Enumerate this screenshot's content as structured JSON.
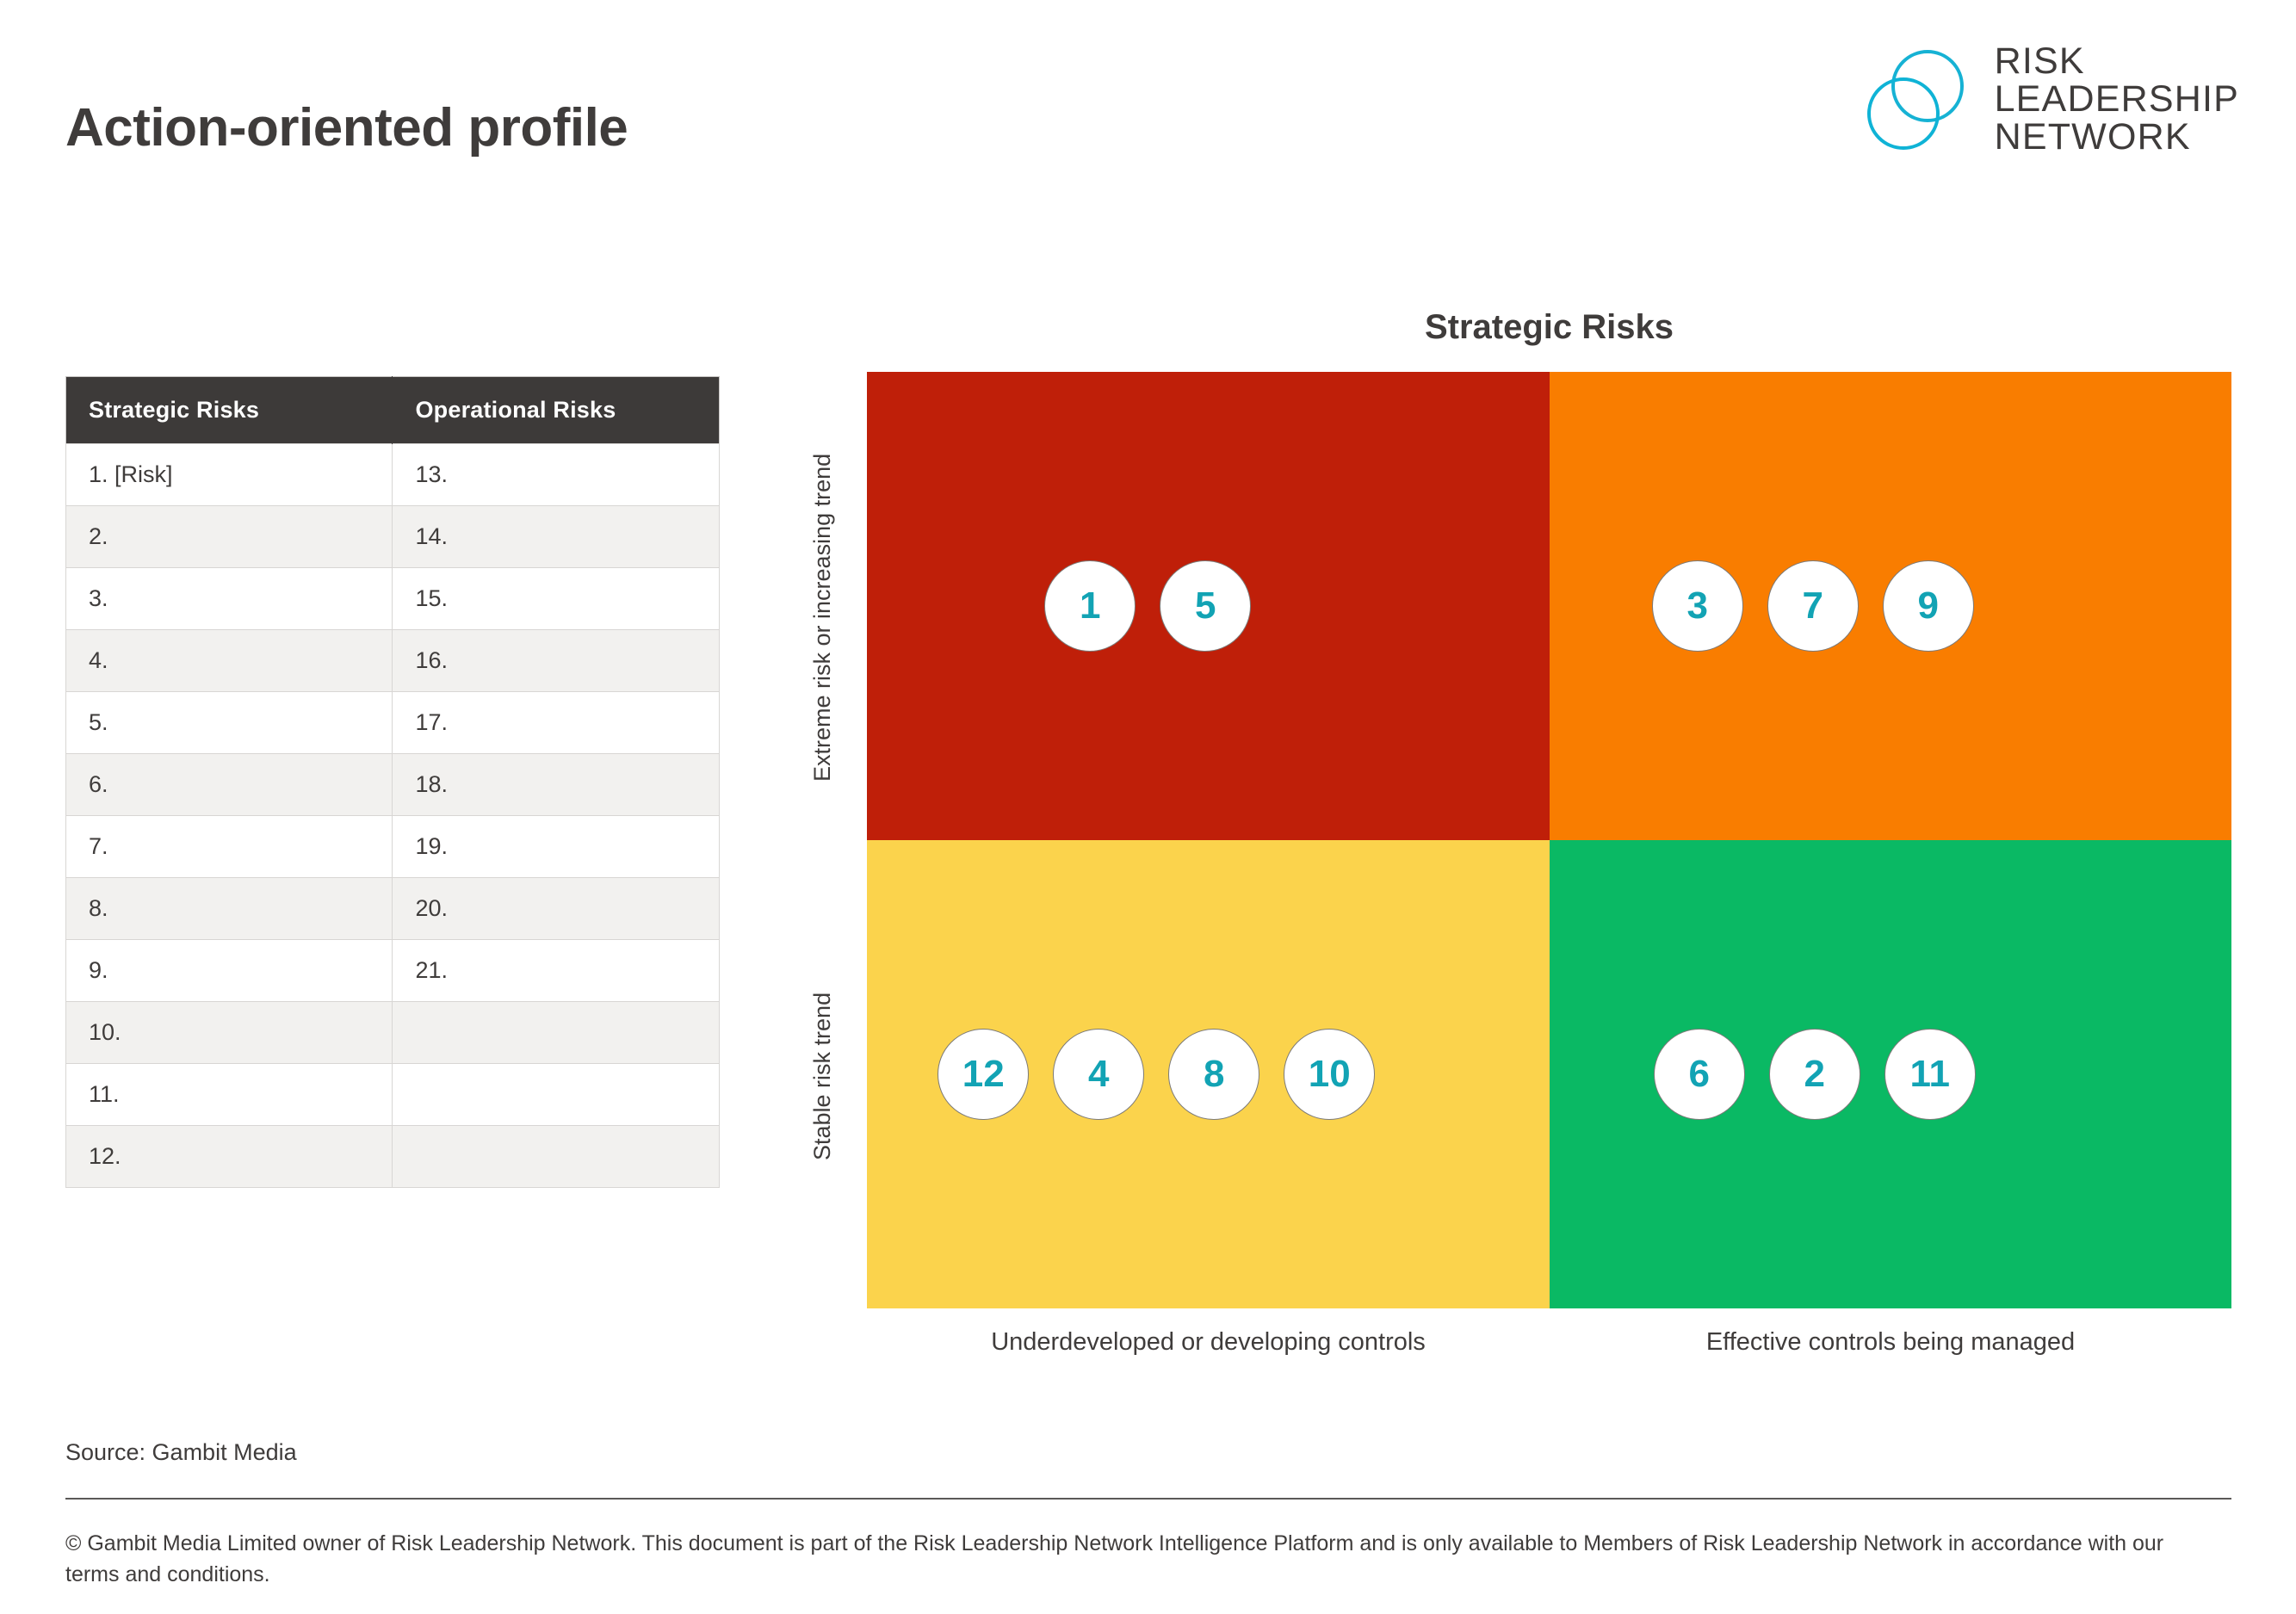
{
  "header": {
    "title": "Action-oriented profile",
    "logo": {
      "icon_name": "two-overlapping-circles-logo",
      "line1": "RISK",
      "line2": "LEADERSHIP",
      "line3": "NETWORK",
      "mark_color": "#16b2d4",
      "text_color": "#3f3c3b"
    }
  },
  "table": {
    "headers": [
      "Strategic Risks",
      "Operational Risks"
    ],
    "header_bg": "#3d3a39",
    "rows": [
      [
        "1. [Risk]",
        "13."
      ],
      [
        "2.",
        "14."
      ],
      [
        "3.",
        "15."
      ],
      [
        "4.",
        "16."
      ],
      [
        "5.",
        "17."
      ],
      [
        "6.",
        "18."
      ],
      [
        "7.",
        "19."
      ],
      [
        "8.",
        "20."
      ],
      [
        "9.",
        "21."
      ],
      [
        "10.",
        ""
      ],
      [
        "11.",
        ""
      ],
      [
        "12.",
        ""
      ]
    ]
  },
  "chart_data": {
    "type": "heatmap",
    "title": "Strategic Risks",
    "xlabel": "",
    "ylabel": "",
    "grid": false,
    "legend": "none",
    "x_categories": [
      "Underdeveloped or developing controls",
      "Effective controls being managed"
    ],
    "y_categories": [
      "Extreme risk or increasing trend",
      "Stable risk trend"
    ],
    "quadrants": [
      {
        "id": "top-left",
        "x": "Underdeveloped or developing controls",
        "y": "Extreme risk or increasing trend",
        "color": "#bf1f09",
        "items": [
          "1",
          "5"
        ]
      },
      {
        "id": "top-right",
        "x": "Effective controls being managed",
        "y": "Extreme risk or increasing trend",
        "color": "#f97d00",
        "items": [
          "3",
          "7",
          "9"
        ]
      },
      {
        "id": "bottom-left",
        "x": "Underdeveloped or developing controls",
        "y": "Stable risk trend",
        "color": "#fbd34c",
        "items": [
          "12",
          "4",
          "8",
          "10"
        ]
      },
      {
        "id": "bottom-right",
        "x": "Effective controls being managed",
        "y": "Stable risk trend",
        "color": "#0ab964",
        "items": [
          "6",
          "2",
          "11"
        ]
      }
    ],
    "bubble_text_color": "#12a3b4",
    "bubble_fill": "#ffffff"
  },
  "footer": {
    "source": "Source: Gambit Media",
    "copyright": "© Gambit Media Limited owner of Risk Leadership Network. This document is part of the Risk Leadership Network Intelligence Platform and is only available to Members of Risk Leadership Network in accordance with our terms and conditions."
  }
}
